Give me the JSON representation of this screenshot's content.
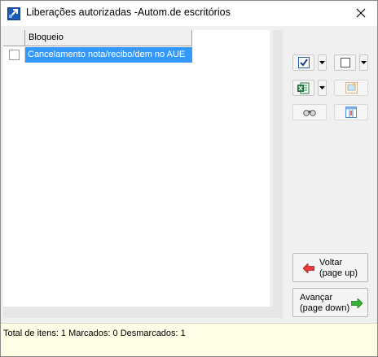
{
  "window": {
    "title": "Liberações autorizadas -Autom.de escritórios",
    "close_symbol": "✕"
  },
  "grid": {
    "columns": [
      "",
      "Bloqueio"
    ],
    "rows": [
      {
        "checked": false,
        "bloqueio": "Cancelamento nota/recibo/dem no AUE",
        "selected": true
      }
    ]
  },
  "toolbar": {
    "buttons": [
      {
        "name": "check-all-icon"
      },
      {
        "name": "uncheck-all-icon"
      },
      {
        "name": "excel-export-icon"
      },
      {
        "name": "image-icon"
      },
      {
        "name": "find-binoculars-icon"
      },
      {
        "name": "columns-icon"
      }
    ]
  },
  "navigation": {
    "back_label_line1": "Voltar",
    "back_label_line2": "(page up)",
    "forward_label_line1": "Avançar",
    "forward_label_line2": "(page down)"
  },
  "status": {
    "summary": "Total de itens: 1 Marcados: 0 Desmarcados: 1"
  },
  "colors": {
    "selection": "#3399ff",
    "status_bg": "#fffde6",
    "back_arrow": "#e83a3a",
    "forward_arrow": "#36b336"
  }
}
